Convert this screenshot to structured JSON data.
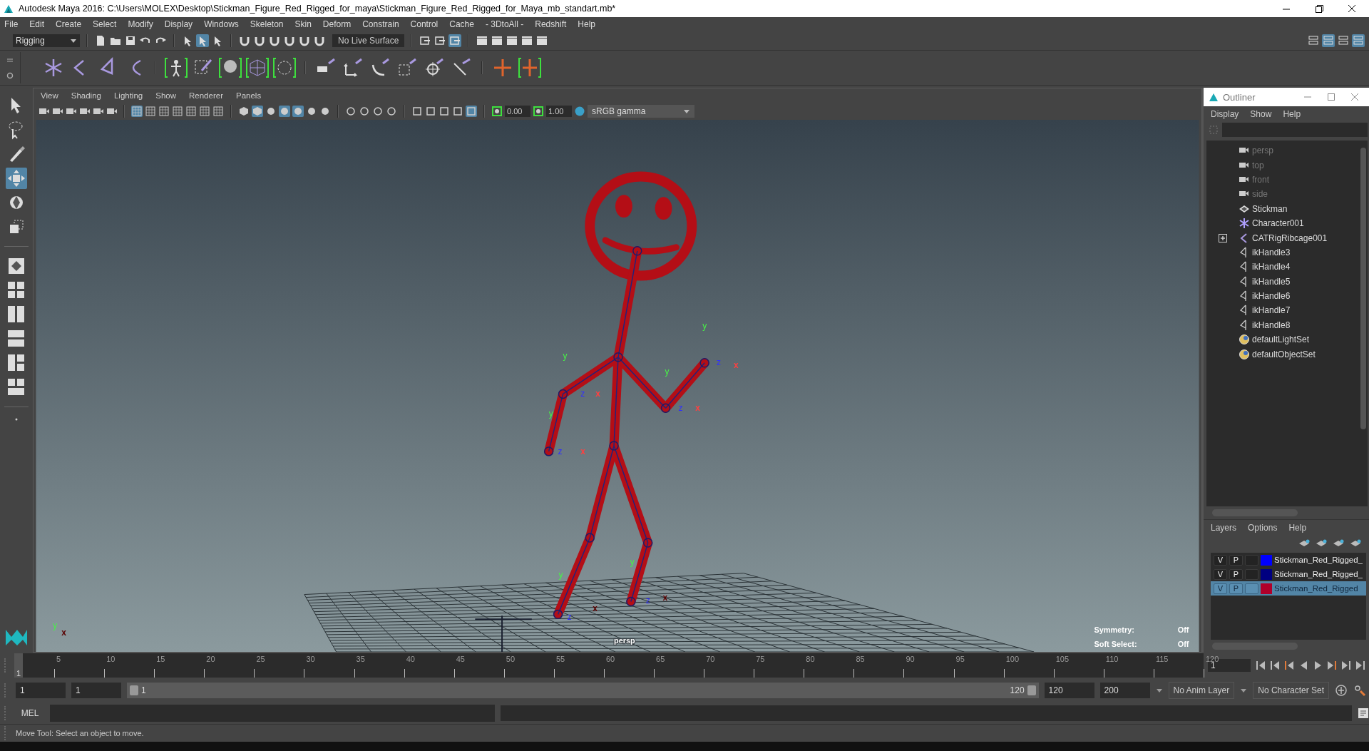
{
  "window": {
    "title": "Autodesk Maya 2016: C:\\Users\\MOLEX\\Desktop\\Stickman_Figure_Red_Rigged_for_maya\\Stickman_Figure_Red_Rigged_for_Maya_mb_standart.mb*"
  },
  "menu": [
    "File",
    "Edit",
    "Create",
    "Select",
    "Modify",
    "Display",
    "Windows",
    "Skeleton",
    "Skin",
    "Deform",
    "Constrain",
    "Control",
    "Cache",
    "- 3DtoAll -",
    "Redshift",
    "Help"
  ],
  "status_line": {
    "menu_set": "Rigging",
    "live_surface": "No Live Surface"
  },
  "toolbox": [
    {
      "kind": "select",
      "selected": false
    },
    {
      "kind": "lasso",
      "selected": false
    },
    {
      "kind": "paint",
      "selected": false
    },
    {
      "kind": "move",
      "selected": true
    },
    {
      "kind": "rotate",
      "selected": false
    },
    {
      "kind": "scale",
      "selected": false
    }
  ],
  "viewport": {
    "menu": [
      "View",
      "Shading",
      "Lighting",
      "Show",
      "Renderer",
      "Panels"
    ],
    "exposure": "0.00",
    "gamma": "1.00",
    "color_space": "sRGB gamma",
    "camera": "persp",
    "hud": [
      {
        "label": "Symmetry:",
        "value": "Off"
      },
      {
        "label": "Soft Select:",
        "value": "Off"
      }
    ],
    "view_axes": {
      "y": "y",
      "x": "x"
    },
    "manipulators": [
      {
        "y": "y",
        "z": "z",
        "x": "x"
      },
      {
        "y": "y",
        "z": "z",
        "x": "x"
      },
      {
        "y": "y",
        "z": "z",
        "x": "x"
      },
      {
        "y": "y",
        "z": "z",
        "x": "x"
      },
      {
        "y": "y",
        "z": "z",
        "x": "x"
      },
      {
        "y": "y",
        "z": "z",
        "x": "x"
      }
    ]
  },
  "outliner": {
    "title": "Outliner",
    "menu": [
      "Display",
      "Show",
      "Help"
    ],
    "items": [
      {
        "kind": "camera",
        "label": "persp",
        "dimmed": true
      },
      {
        "kind": "camera",
        "label": "top",
        "dimmed": true
      },
      {
        "kind": "camera",
        "label": "front",
        "dimmed": true
      },
      {
        "kind": "camera",
        "label": "side",
        "dimmed": true
      },
      {
        "kind": "mesh",
        "label": "Stickman",
        "dimmed": false
      },
      {
        "kind": "character",
        "label": "Character001",
        "dimmed": false
      },
      {
        "kind": "joint",
        "label": "CATRigRibcage001",
        "dimmed": false,
        "expanded": false
      },
      {
        "kind": "ik",
        "label": "ikHandle3",
        "dimmed": false
      },
      {
        "kind": "ik",
        "label": "ikHandle4",
        "dimmed": false
      },
      {
        "kind": "ik",
        "label": "ikHandle5",
        "dimmed": false
      },
      {
        "kind": "ik",
        "label": "ikHandle6",
        "dimmed": false
      },
      {
        "kind": "ik",
        "label": "ikHandle7",
        "dimmed": false
      },
      {
        "kind": "ik",
        "label": "ikHandle8",
        "dimmed": false
      },
      {
        "kind": "set",
        "label": "defaultLightSet",
        "dimmed": false
      },
      {
        "kind": "set",
        "label": "defaultObjectSet",
        "dimmed": false
      }
    ]
  },
  "layers": {
    "menu": [
      "Layers",
      "Options",
      "Help"
    ],
    "rows": [
      {
        "visible": "V",
        "playback": "P",
        "color": "#0000ff",
        "name": "Stickman_Red_Rigged_",
        "selected": false
      },
      {
        "visible": "V",
        "playback": "P",
        "color": "#000080",
        "name": "Stickman_Red_Rigged_",
        "selected": false
      },
      {
        "visible": "V",
        "playback": "P",
        "color": "#b0002a",
        "name": "Stickman_Red_Rigged",
        "selected": true
      }
    ]
  },
  "timeline": {
    "current": "1",
    "level": 0,
    "ticks": [
      "5",
      "10",
      "15",
      "20",
      "25",
      "30",
      "35",
      "40",
      "45",
      "50",
      "55",
      "60",
      "65",
      "70",
      "75",
      "80",
      "85",
      "90",
      "95",
      "100",
      "105",
      "110",
      "115",
      "120"
    ],
    "frame_field": "1"
  },
  "range": {
    "start": "1",
    "playback_start": "1",
    "slider_start": "1",
    "slider_end": "120",
    "level": 1,
    "playback_end": "120",
    "end": "200",
    "anim_layer": "No Anim Layer",
    "character_set": "No Character Set"
  },
  "command_line": {
    "label": "MEL"
  },
  "help_line": "Move Tool: Select an object to move."
}
